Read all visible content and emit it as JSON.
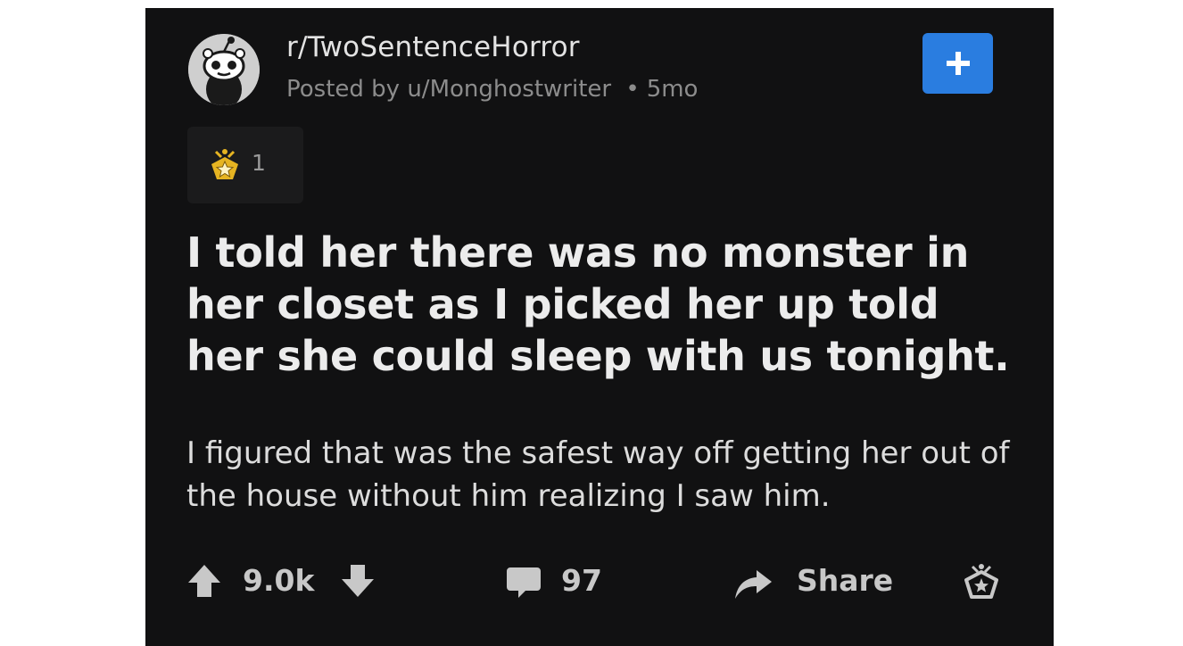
{
  "post": {
    "subreddit": "r/TwoSentenceHorror",
    "posted_by_prefix": "Posted by",
    "author": "u/Monghostwriter",
    "separator": "•",
    "age": "5mo",
    "award_count": "1",
    "title": "I told her there was no monster in her closet as I picked her up told her she could sleep with us tonight.",
    "body": "I figured that was the safest way off getting her out of the house without him realizing I saw him."
  },
  "actions": {
    "vote_count": "9.0k",
    "comment_count": "97",
    "share_label": "Share"
  },
  "icons": {
    "avatar": "subreddit-snoo-avatar",
    "join": "plus-icon",
    "award": "gold-award-icon",
    "upvote": "arrow-up-icon",
    "downvote": "arrow-down-icon",
    "comments": "comment-bubble-icon",
    "share": "share-arrow-icon",
    "give_award": "award-outline-icon"
  },
  "colors": {
    "background": "#111112",
    "accent": "#2a7de0",
    "text_primary": "#ececec",
    "text_muted": "#8c8c8c",
    "award_gold": "#e6b422"
  }
}
